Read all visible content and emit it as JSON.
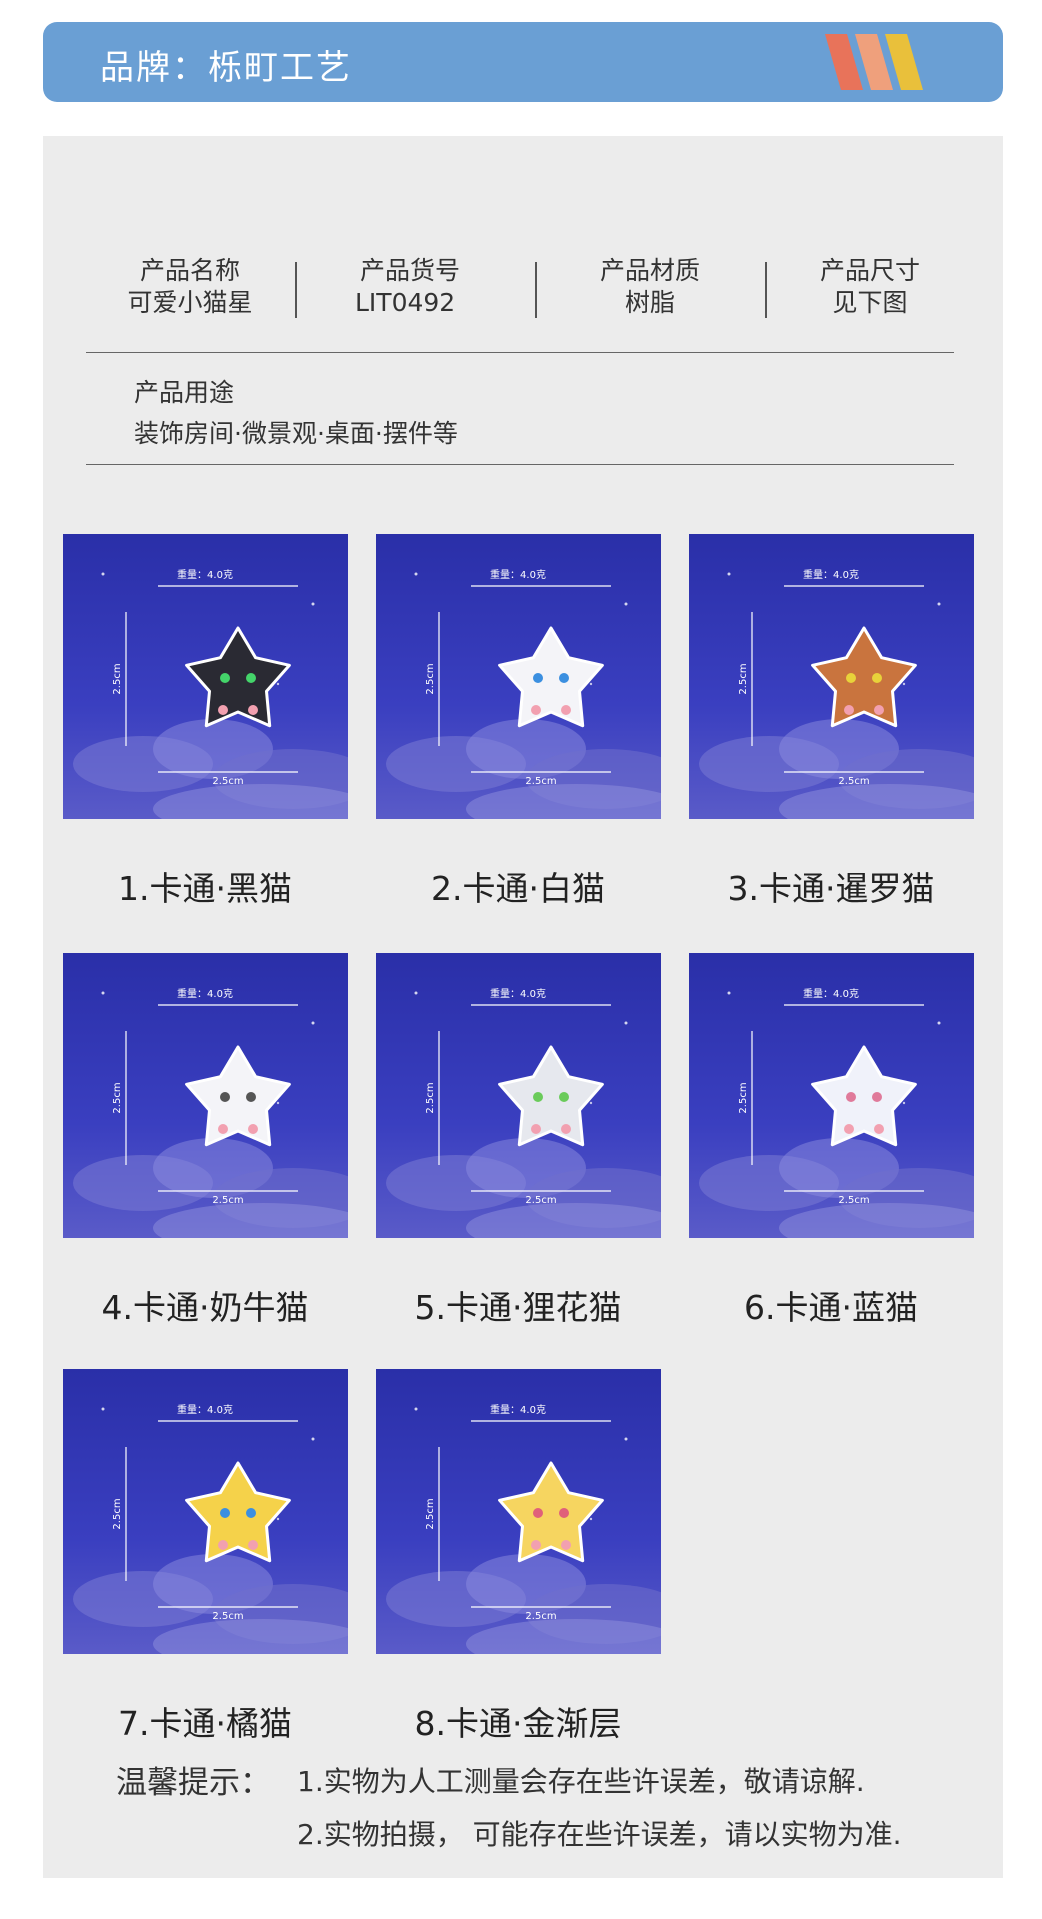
{
  "header": {
    "title": "品牌：栎町工艺",
    "stripe_colors": [
      "#e8735a",
      "#efa07c",
      "#e9c03b"
    ]
  },
  "info": {
    "name_label": "产品名称",
    "name_value": "可爱小猫星",
    "sku_label": "产品货号",
    "sku_value": "LIT0492",
    "material_label": "产品材质",
    "material_value": "树脂",
    "size_label": "产品尺寸",
    "size_value": "见下图",
    "usage_label": "产品用途",
    "usage_value": "装饰房间·微景观·桌面·摆件等"
  },
  "card_labels": {
    "weight": "重量：4.0克",
    "height": "2.5cm",
    "width": "2.5cm"
  },
  "products": [
    {
      "caption": "1.卡通·黑猫",
      "body_color": "#2a2a33",
      "eye_color": "#44d46a"
    },
    {
      "caption": "2.卡通·白猫",
      "body_color": "#f4f4f8",
      "eye_color": "#3b8fe0"
    },
    {
      "caption": "3.卡通·暹罗猫",
      "body_color": "#c9743e",
      "eye_color": "#e8d23a"
    },
    {
      "caption": "4.卡通·奶牛猫",
      "body_color": "#f4f4f8",
      "eye_color": "#555555"
    },
    {
      "caption": "5.卡通·狸花猫",
      "body_color": "#e6e8ee",
      "eye_color": "#6acb5a"
    },
    {
      "caption": "6.卡通·蓝猫",
      "body_color": "#f0f2fa",
      "eye_color": "#e07a9a"
    },
    {
      "caption": "7.卡通·橘猫",
      "body_color": "#f5d24a",
      "eye_color": "#3b8fe0"
    },
    {
      "caption": "8.卡通·金渐层",
      "body_color": "#f6d560",
      "eye_color": "#e0607a"
    }
  ],
  "notes": {
    "label": "温馨提示：",
    "line1": "1.实物为人工测量会存在些许误差，敬请谅解.",
    "line2": "2.实物拍摄，  可能存在些许误差，请以实物为准."
  }
}
